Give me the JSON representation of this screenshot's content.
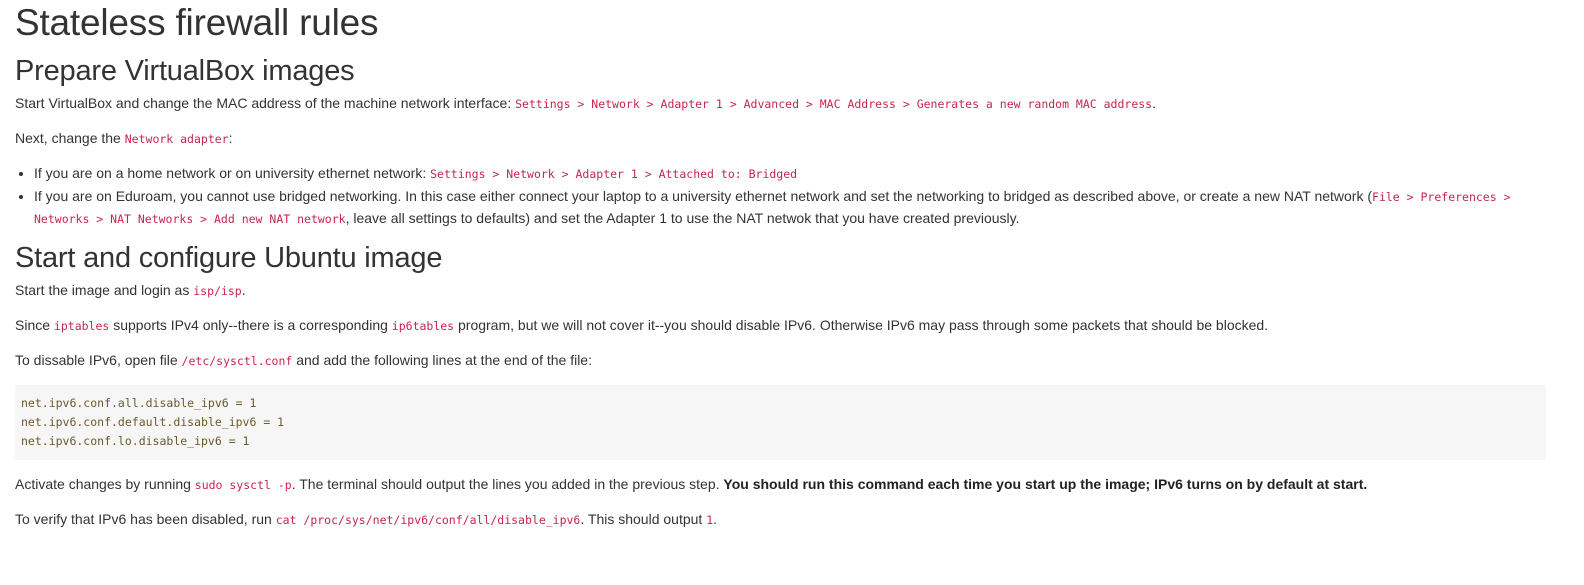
{
  "title": "Stateless firewall rules",
  "section1": {
    "heading": "Prepare VirtualBox images",
    "p1_text": "Start VirtualBox and change the MAC address of the machine network interface: ",
    "p1_code": "Settings > Network > Adapter 1 > Advanced > MAC Address > Generates a new random MAC address",
    "p1_end": ".",
    "p2_text": "Next, change the ",
    "p2_code": "Network adapter",
    "p2_end": ":",
    "bullet1_text": "If you are on a home network or on university ethernet network: ",
    "bullet1_code": "Settings > Network > Adapter 1 > Attached to: Bridged",
    "bullet2_text": "If you are on Eduroam, you cannot use bridged networking. In this case either connect your laptop to a university ethernet network and set the networking to bridged as described above, or create a new NAT network (",
    "bullet2_code": "File > Preferences > Networks > NAT Networks > Add new NAT network",
    "bullet2_end": ", leave all settings to defaults) and set the Adapter 1 to use the NAT netwok that you have created previously."
  },
  "section2": {
    "heading": "Start and configure Ubuntu image",
    "p1_text": "Start the image and login as ",
    "p1_code": "isp/isp",
    "p1_end": ".",
    "p2_a": "Since ",
    "p2_code1": "iptables",
    "p2_b": " supports IPv4 only--there is a corresponding ",
    "p2_code2": "ip6tables",
    "p2_c": " program, but we will not cover it--you should disable IPv6. Otherwise IPv6 may pass through some packets that should be blocked.",
    "p3_text": "To dissable IPv6, open file ",
    "p3_code": "/etc/sysctl.conf",
    "p3_end": " and add the following lines at the end of the file:",
    "code_lines": [
      "net.ipv6.conf.all.disable_ipv6 = 1",
      "net.ipv6.conf.default.disable_ipv6 = 1",
      "net.ipv6.conf.lo.disable_ipv6 = 1"
    ],
    "p4_text": "Activate changes by running ",
    "p4_code": "sudo sysctl -p",
    "p4_mid": ". The terminal should output the lines you added in the previous step. ",
    "p4_bold": "You should run this command each time you start up the image; IPv6 turns on by default at start.",
    "p5_text": "To verify that IPv6 has been disabled, run ",
    "p5_code": "cat /proc/sys/net/ipv6/conf/all/disable_ipv6",
    "p5_mid": ". This should output ",
    "p5_code2": "1",
    "p5_end": "."
  }
}
